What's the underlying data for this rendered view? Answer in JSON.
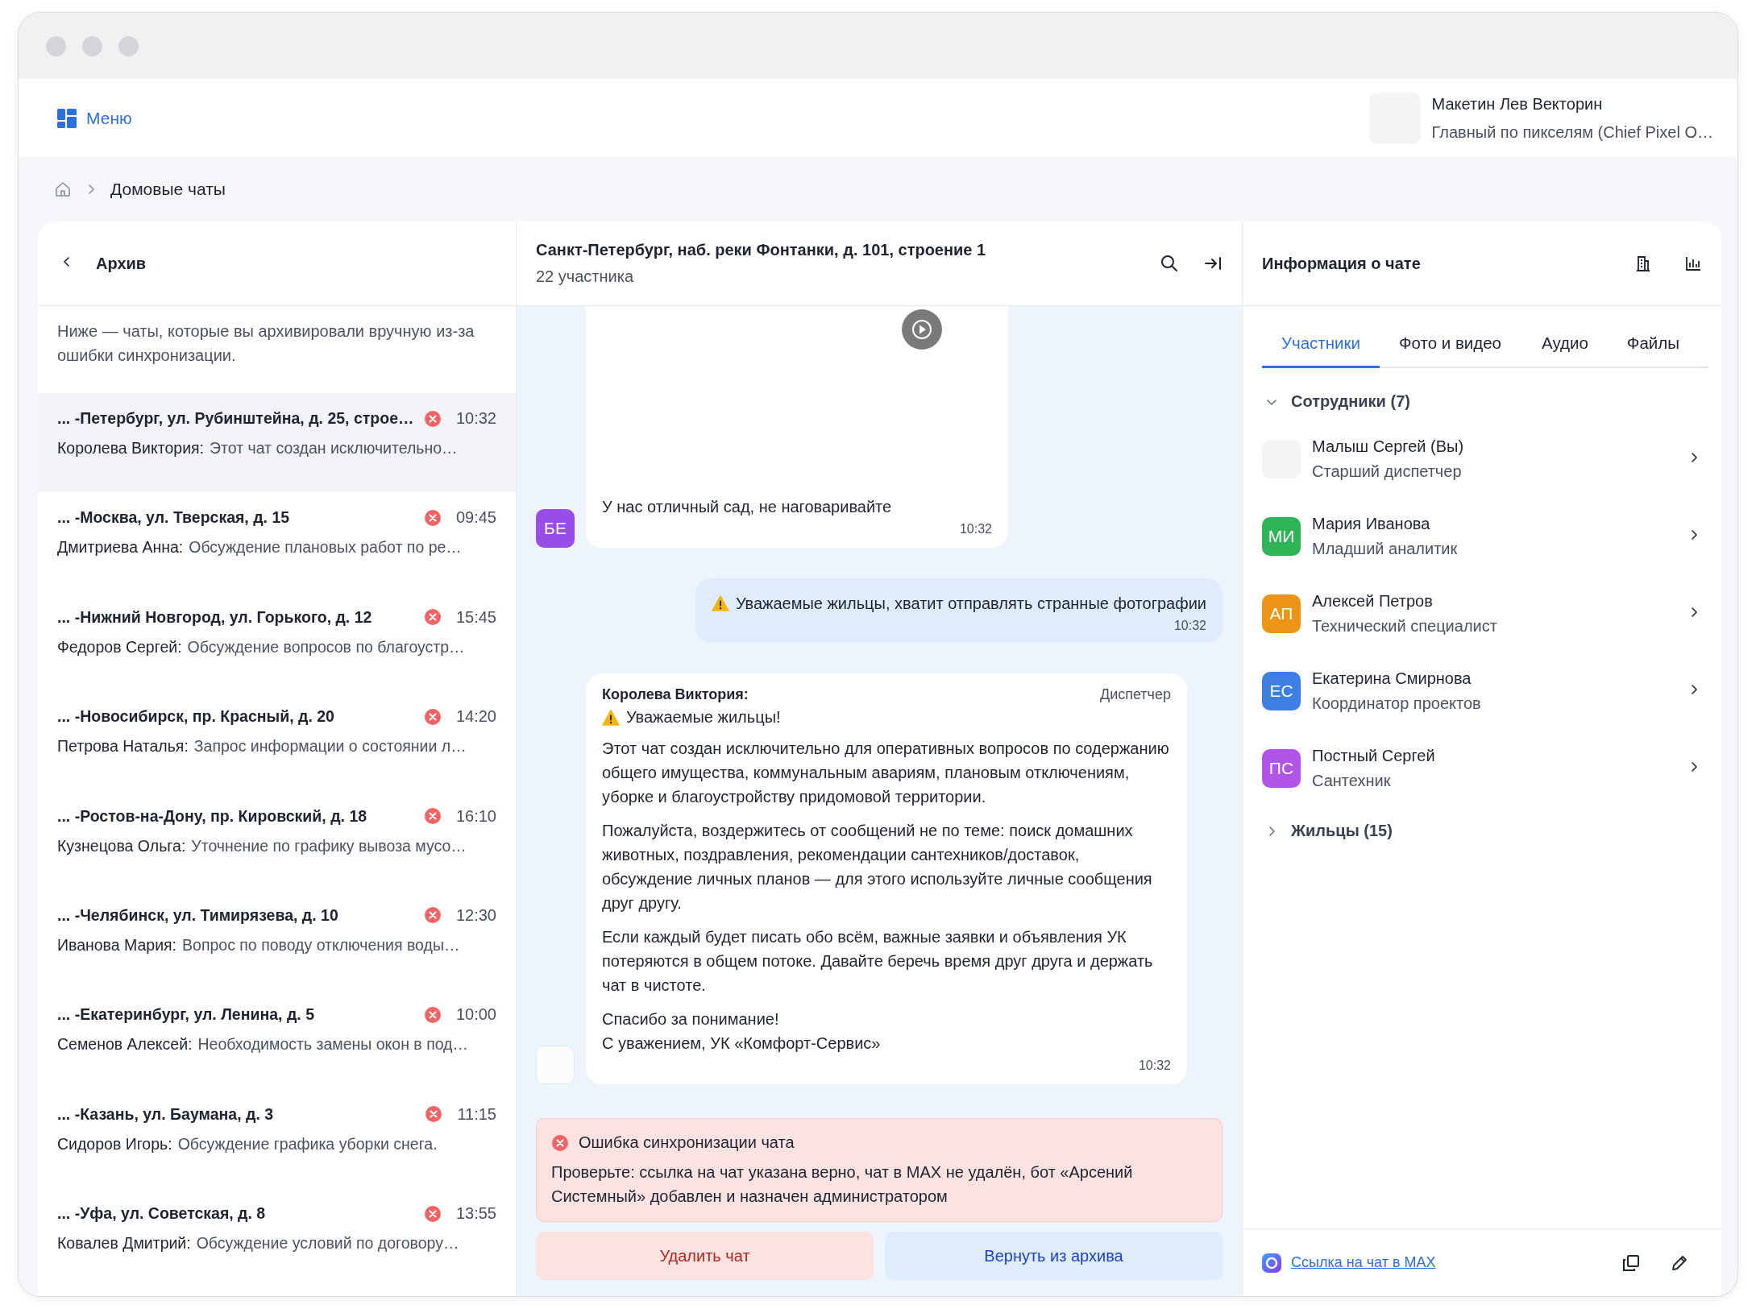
{
  "topbar": {
    "menu_label": "Меню",
    "user": {
      "name": "Макетин Лев Векторин",
      "role": "Главный по пикселям (Chief Pixel O…"
    }
  },
  "breadcrumb": [
    "Домовые чаты"
  ],
  "archive": {
    "title": "Архив",
    "note": "Ниже — чаты, которые вы архивировали вручную из-за ошибки синхронизации.",
    "chats": [
      {
        "title": "... -Петербург, ул. Рубинштейна, д. 25, строе…",
        "time": "10:32",
        "author": "Королева Виктория:",
        "preview": "Этот чат создан исключительно…",
        "selected": true,
        "error": true
      },
      {
        "title": "... -Москва, ул. Тверская, д. 15",
        "time": "09:45",
        "author": "Дмитриева Анна:",
        "preview": "Обсуждение плановых работ по ре…",
        "selected": false,
        "error": true
      },
      {
        "title": "... -Нижний Новгород, ул. Горького, д. 12",
        "time": "15:45",
        "author": "Федоров Сергей:",
        "preview": "Обсуждение вопросов по благоустр…",
        "selected": false,
        "error": true
      },
      {
        "title": "... -Новосибирск, пр. Красный, д. 20",
        "time": "14:20",
        "author": "Петрова Наталья:",
        "preview": "Запрос информации о состоянии л…",
        "selected": false,
        "error": true
      },
      {
        "title": "... -Ростов-на-Дону, пр. Кировский, д. 18",
        "time": "16:10",
        "author": "Кузнецова Ольга:",
        "preview": "Уточнение по графику вывоза мусо…",
        "selected": false,
        "error": true
      },
      {
        "title": "... -Челябинск, ул. Тимирязева, д. 10",
        "time": "12:30",
        "author": "Иванова Мария:",
        "preview": "Вопрос по поводу отключения воды…",
        "selected": false,
        "error": true
      },
      {
        "title": "... -Екатеринбург, ул. Ленина, д. 5",
        "time": "10:00",
        "author": "Семенов Алексей:",
        "preview": "Необходимость замены окон в под…",
        "selected": false,
        "error": true
      },
      {
        "title": "... -Казань, ул. Баумана, д. 3",
        "time": "11:15",
        "author": "Сидоров Игорь:",
        "preview": "Обсуждение графика уборки снега.",
        "selected": false,
        "error": true
      },
      {
        "title": "... -Уфа, ул. Советская, д. 8",
        "time": "13:55",
        "author": "Ковалев Дмитрий:",
        "preview": "Обсуждение условий по договору…",
        "selected": false,
        "error": true
      }
    ]
  },
  "chat": {
    "title": "Санкт-Петербург, наб. реки Фонтанки, д. 101, строение 1",
    "subtitle": "22 участника",
    "messages": [
      {
        "kind": "media",
        "initials": "БЕ",
        "color": "#9a4de6",
        "text": "У нас отличный сад, не наговаривайте",
        "time": "10:32"
      },
      {
        "kind": "outgoing",
        "warning": true,
        "text": "Уважаемые жильцы, хватит отправлять странные фотографии",
        "time": "10:32"
      },
      {
        "kind": "announcement",
        "author": "Королева Виктория:",
        "role": "Диспетчер",
        "warning": true,
        "headline": "Уважаемые жильцы!",
        "paragraphs": [
          "Этот чат создан исключительно для оперативных вопросов по содержанию общего имущества, коммунальным авариям, плановым отключениям, уборке и благоустройству придомовой территории.",
          "Пожалуйста, воздержитесь от сообщений не по теме: поиск домашних животных, поздравления, рекомендации сантехников/доставок, обсуждение личных планов — для этого используйте личные сообщения друг другу.",
          "Если каждый будет писать обо всём, важные заявки и объявления УК потеряются в общем потоке. Давайте беречь время друг друга и держать чат в чистоте.",
          "Спасибо за понимание!\nС уважением, УК «Комфорт-Сервис»"
        ],
        "time": "10:32"
      }
    ],
    "error": {
      "title": "Ошибка синхронизации чата",
      "text": "Проверьте: ссылка на чат указана верно, чат в MAX не удалён, бот «Арсений Системный» добавлен и назначен администратором"
    },
    "actions": [
      {
        "label": "Удалить чат",
        "kind": "danger"
      },
      {
        "label": "Вернуть из архива",
        "kind": "primary"
      }
    ]
  },
  "info": {
    "title": "Информация о чате",
    "tabs": [
      {
        "label": "Участники",
        "selected": true
      },
      {
        "label": "Фото и видео",
        "selected": false
      },
      {
        "label": "Аудио",
        "selected": false
      },
      {
        "label": "Файлы",
        "selected": false
      }
    ],
    "groups": [
      {
        "label": "Сотрудники (7)",
        "expanded": true,
        "members": [
          {
            "name": "Малыш Сергей (Вы)",
            "role": "Старший диспетчер"
          },
          {
            "name": "Мария Иванова",
            "role": "Младший аналитик",
            "initials": "МИ",
            "color": "#2fb457"
          },
          {
            "name": "Алексей Петров",
            "role": "Технический специалист",
            "initials": "АП",
            "color": "#ec9416"
          },
          {
            "name": "Екатерина Смирнова",
            "role": "Координатор проектов",
            "initials": "ЕС",
            "color": "#3f7fe3"
          },
          {
            "name": "Постный Сергей",
            "role": "Сантехник",
            "initials": "ПС",
            "color": "#b055e8"
          }
        ]
      },
      {
        "label": "Жильцы (15)",
        "expanded": false
      }
    ],
    "link": "Ссылка на чат в MAX"
  }
}
